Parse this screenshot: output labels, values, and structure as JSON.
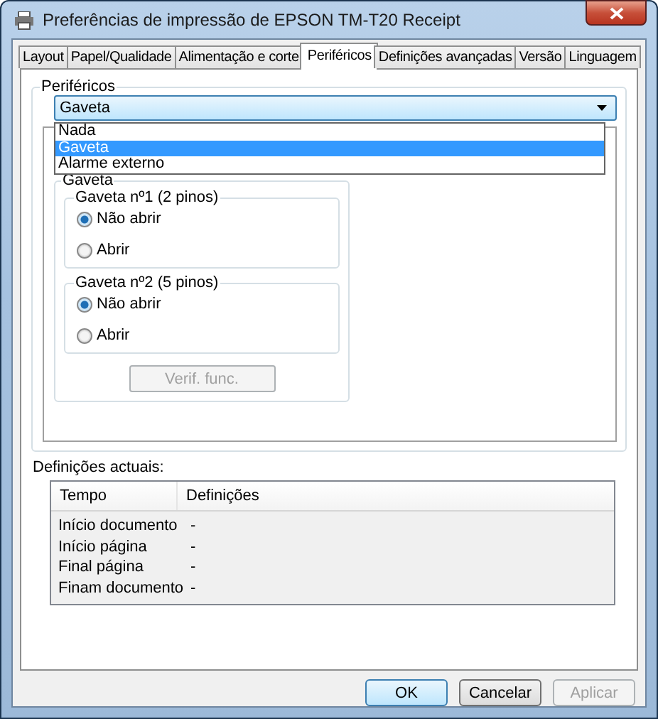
{
  "window": {
    "title": "Preferências de impressão de EPSON TM-T20 Receipt"
  },
  "tabs": [
    {
      "label": "Layout",
      "selected": false
    },
    {
      "label": "Papel/Qualidade",
      "selected": false
    },
    {
      "label": "Alimentação e corte",
      "selected": false
    },
    {
      "label": "Periféricos",
      "selected": true
    },
    {
      "label": "Definições avançadas",
      "selected": false
    },
    {
      "label": "Versão",
      "selected": false
    },
    {
      "label": "Linguagem",
      "selected": false
    }
  ],
  "peripherals": {
    "label": "Periféricos",
    "combo_value": "Gaveta",
    "dropdown_options": [
      {
        "label": "Nada",
        "selected": false
      },
      {
        "label": "Gaveta",
        "selected": true
      },
      {
        "label": "Alarme externo",
        "selected": false
      }
    ],
    "drawer_group": {
      "title": "Gaveta",
      "drawers": [
        {
          "title": "Gaveta nº1 (2 pinos)",
          "options": [
            {
              "label": "Não abrir",
              "selected": true
            },
            {
              "label": "Abrir",
              "selected": false
            }
          ]
        },
        {
          "title": "Gaveta nº2 (5 pinos)",
          "options": [
            {
              "label": "Não abrir",
              "selected": true
            },
            {
              "label": "Abrir",
              "selected": false
            }
          ]
        }
      ],
      "test_button": {
        "label": "Verif. func.",
        "disabled": true
      }
    }
  },
  "current_settings": {
    "label": "Definições actuais:",
    "columns": [
      "Tempo",
      "Definições"
    ],
    "rows": [
      {
        "time": "Início documento",
        "setting": "-"
      },
      {
        "time": "Início página",
        "setting": "-"
      },
      {
        "time": "Final página",
        "setting": "-"
      },
      {
        "time": "Finam documento",
        "setting": "-"
      }
    ]
  },
  "buttons": [
    {
      "label": "OK",
      "kind": "default",
      "disabled": false
    },
    {
      "label": "Cancelar",
      "kind": "normal",
      "disabled": false
    },
    {
      "label": "Aplicar",
      "kind": "normal",
      "disabled": true
    }
  ]
}
